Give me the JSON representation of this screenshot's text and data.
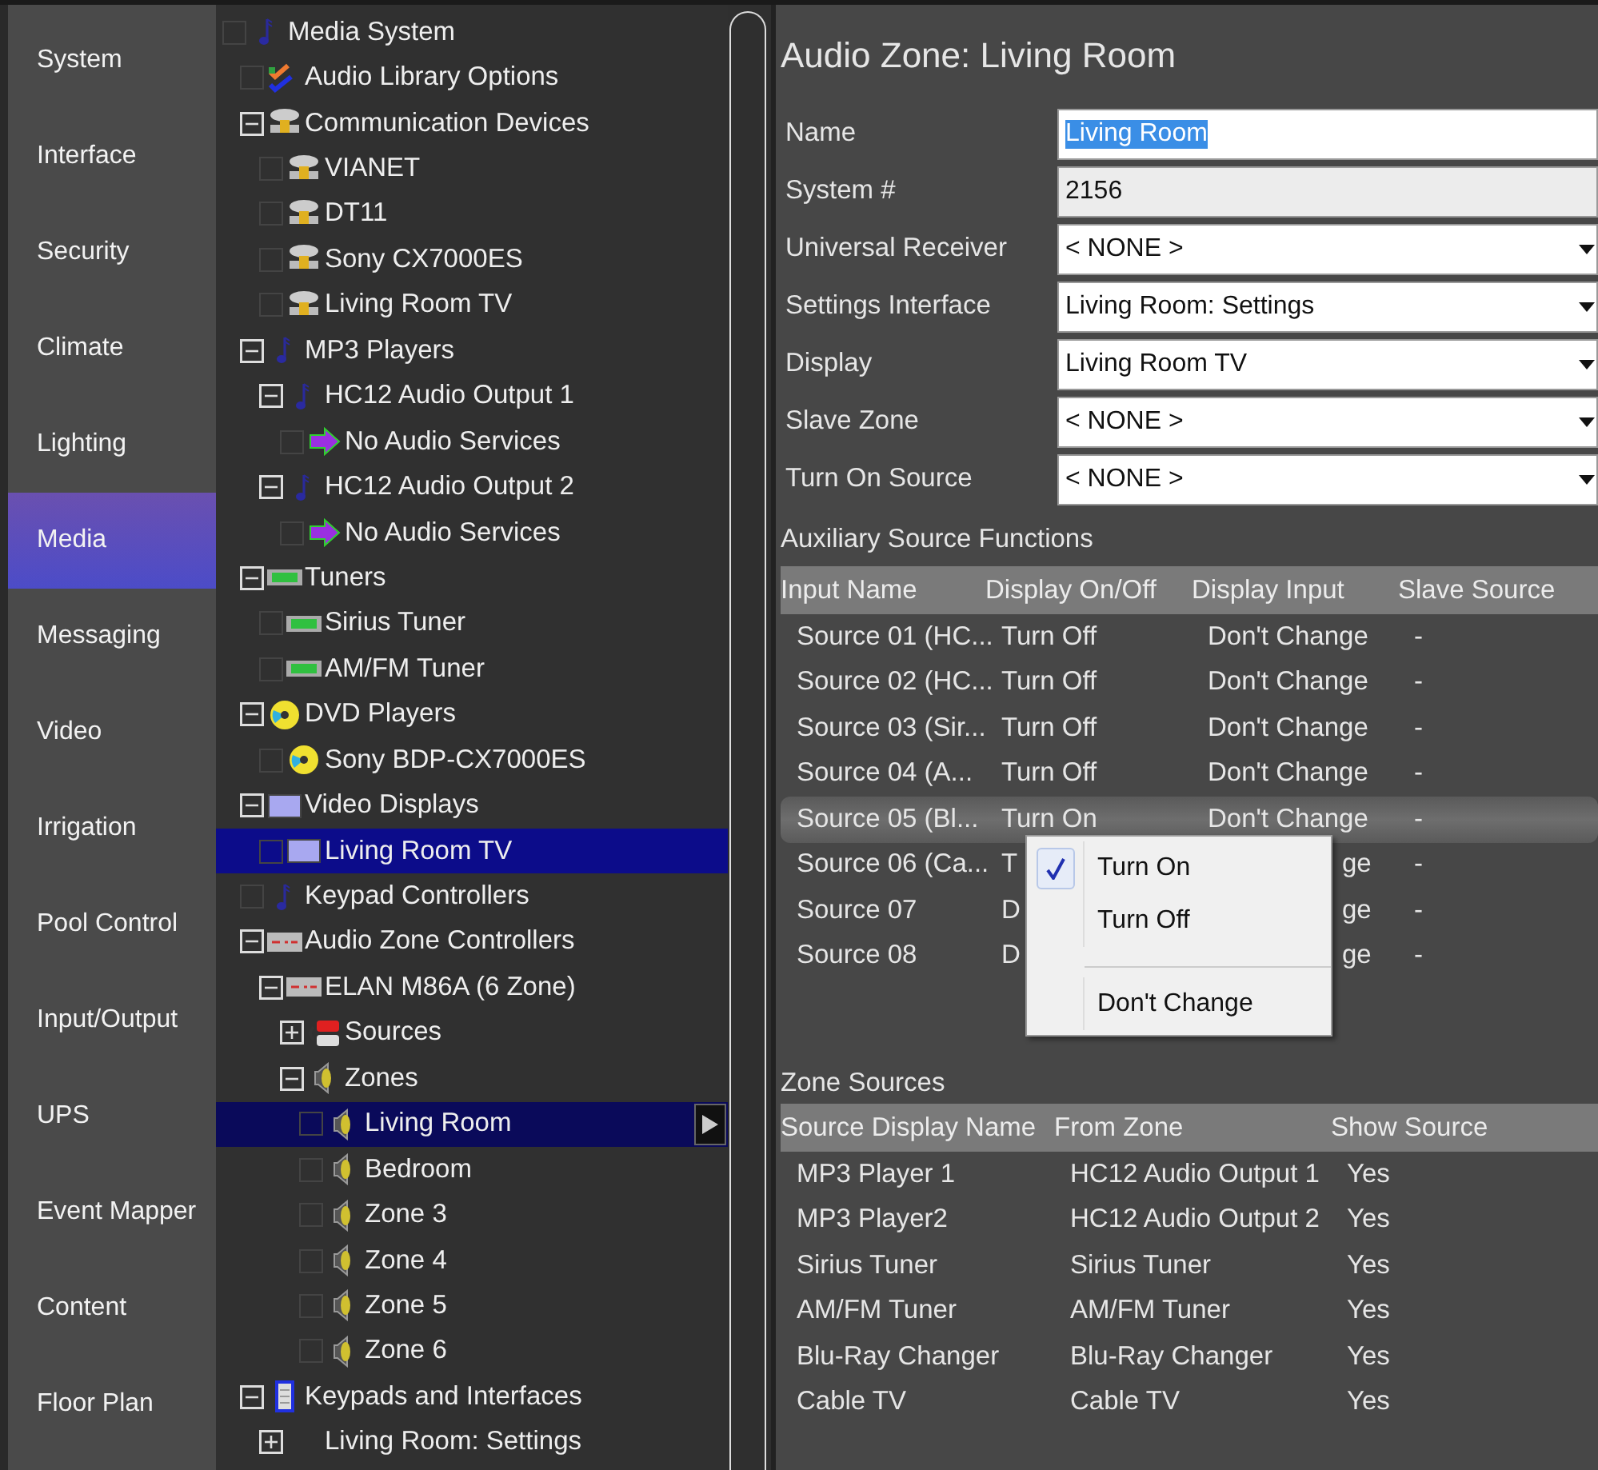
{
  "sidebar": {
    "items": [
      {
        "label": "System",
        "selected": false
      },
      {
        "label": "Interface",
        "selected": false
      },
      {
        "label": "Security",
        "selected": false
      },
      {
        "label": "Climate",
        "selected": false
      },
      {
        "label": "Lighting",
        "selected": false
      },
      {
        "label": "Media",
        "selected": true
      },
      {
        "label": "Messaging",
        "selected": false
      },
      {
        "label": "Video",
        "selected": false
      },
      {
        "label": "Irrigation",
        "selected": false
      },
      {
        "label": "Pool Control",
        "selected": false
      },
      {
        "label": "Input/Output",
        "selected": false
      },
      {
        "label": "UPS",
        "selected": false
      },
      {
        "label": "Event Mapper",
        "selected": false
      },
      {
        "label": "Content",
        "selected": false
      },
      {
        "label": "Floor Plan",
        "selected": false
      }
    ]
  },
  "tree": [
    {
      "label": "Media System",
      "kind": "note",
      "checked": false,
      "selected": false,
      "children": [
        {
          "label": "Audio Library Options",
          "kind": "checklist",
          "checked": false,
          "selected": false
        },
        {
          "label": "Communication Devices",
          "kind": "server",
          "expanded": true,
          "selected": false,
          "children": [
            {
              "label": "VIANET",
              "kind": "server",
              "checked": false,
              "selected": false
            },
            {
              "label": "DT11",
              "kind": "server",
              "checked": false,
              "selected": false
            },
            {
              "label": "Sony CX7000ES",
              "kind": "server",
              "checked": false,
              "selected": false
            },
            {
              "label": "Living Room TV",
              "kind": "server",
              "checked": false,
              "selected": false
            }
          ]
        },
        {
          "label": "MP3 Players",
          "kind": "note",
          "expanded": true,
          "selected": false,
          "children": [
            {
              "label": "HC12 Audio Output 1",
              "kind": "note",
              "expanded": true,
              "selected": false,
              "children": [
                {
                  "label": "No Audio Services",
                  "kind": "arrow",
                  "checked": false,
                  "selected": false
                }
              ]
            },
            {
              "label": "HC12 Audio Output 2",
              "kind": "note",
              "expanded": true,
              "selected": false,
              "children": [
                {
                  "label": "No Audio Services",
                  "kind": "arrow",
                  "checked": false,
                  "selected": false
                }
              ]
            }
          ]
        },
        {
          "label": "Tuners",
          "kind": "tuner",
          "expanded": true,
          "selected": false,
          "children": [
            {
              "label": "Sirius Tuner",
              "kind": "tuner",
              "checked": false,
              "selected": false
            },
            {
              "label": "AM/FM Tuner",
              "kind": "tuner",
              "checked": false,
              "selected": false
            }
          ]
        },
        {
          "label": "DVD Players",
          "kind": "disc",
          "expanded": true,
          "selected": false,
          "children": [
            {
              "label": "Sony BDP-CX7000ES",
              "kind": "disc",
              "checked": false,
              "selected": false
            }
          ]
        },
        {
          "label": "Video Displays",
          "kind": "display",
          "expanded": true,
          "selected": false,
          "children": [
            {
              "label": "Living Room TV",
              "kind": "display",
              "checked": false,
              "selected": true
            }
          ]
        },
        {
          "label": "Keypad Controllers",
          "kind": "note",
          "checked": false,
          "selected": false
        },
        {
          "label": "Audio Zone Controllers",
          "kind": "amp",
          "expanded": true,
          "selected": false,
          "children": [
            {
              "label": "ELAN M86A (6 Zone)",
              "kind": "amp",
              "expanded": true,
              "selected": false,
              "children": [
                {
                  "label": "Sources",
                  "kind": "plugs",
                  "expanded": false,
                  "selected": false
                },
                {
                  "label": "Zones",
                  "kind": "speaker",
                  "expanded": true,
                  "selected": false,
                  "children": [
                    {
                      "label": "Living Room",
                      "kind": "speaker",
                      "checked": false,
                      "selected": true,
                      "action_button": true
                    },
                    {
                      "label": "Bedroom",
                      "kind": "speaker",
                      "checked": false,
                      "selected": false
                    },
                    {
                      "label": "Zone 3",
                      "kind": "speaker",
                      "checked": false,
                      "selected": false
                    },
                    {
                      "label": "Zone 4",
                      "kind": "speaker",
                      "checked": false,
                      "selected": false
                    },
                    {
                      "label": "Zone 5",
                      "kind": "speaker",
                      "checked": false,
                      "selected": false
                    },
                    {
                      "label": "Zone 6",
                      "kind": "speaker",
                      "checked": false,
                      "selected": false
                    }
                  ]
                }
              ]
            }
          ]
        },
        {
          "label": "Keypads and Interfaces",
          "kind": "keypad",
          "expanded": true,
          "selected": false,
          "children": [
            {
              "label": "Living Room: Settings",
              "kind": "none",
              "expanded": false,
              "selected": false
            }
          ]
        }
      ]
    }
  ],
  "panel": {
    "title": "Audio Zone: Living Room",
    "fields": [
      {
        "label": "Name",
        "kind": "text",
        "value": "Living Room",
        "value_selected": true
      },
      {
        "label": "System #",
        "kind": "readonly",
        "value": "2156"
      },
      {
        "label": "Universal Receiver",
        "kind": "dropdown",
        "value": "< NONE >"
      },
      {
        "label": "Settings Interface",
        "kind": "dropdown",
        "value": "Living Room: Settings"
      },
      {
        "label": "Display",
        "kind": "dropdown",
        "value": "Living Room TV"
      },
      {
        "label": "Slave Zone",
        "kind": "dropdown",
        "value": "< NONE >"
      },
      {
        "label": "Turn On Source",
        "kind": "dropdown",
        "value": "< NONE >"
      }
    ],
    "aux": {
      "title": "Auxiliary Source Functions",
      "columns": [
        "Input Name",
        "Display On/Off",
        "Display Input",
        "Slave Source"
      ],
      "rows": [
        {
          "cells": [
            "Source 01 (HC...",
            "Turn Off",
            "Don't Change",
            "-"
          ],
          "selected": false,
          "under_menu": false
        },
        {
          "cells": [
            "Source 02 (HC...",
            "Turn Off",
            "Don't Change",
            "-"
          ],
          "selected": false,
          "under_menu": false
        },
        {
          "cells": [
            "Source 03 (Sir...",
            "Turn Off",
            "Don't Change",
            "-"
          ],
          "selected": false,
          "under_menu": false
        },
        {
          "cells": [
            "Source 04 (A...",
            "Turn Off",
            "Don't Change",
            "-"
          ],
          "selected": false,
          "under_menu": false
        },
        {
          "cells": [
            "Source 05 (Bl...",
            "Turn On",
            "Don't Change",
            "-"
          ],
          "selected": true,
          "under_menu": false
        },
        {
          "cells": [
            "Source 06 (Ca...",
            "T",
            "ge",
            "-"
          ],
          "selected": false,
          "under_menu": true
        },
        {
          "cells": [
            "Source 07",
            "D",
            "ge",
            "-"
          ],
          "selected": false,
          "under_menu": true
        },
        {
          "cells": [
            "Source 08",
            "D",
            "ge",
            "-"
          ],
          "selected": false,
          "under_menu": true
        }
      ],
      "menu": {
        "items": [
          {
            "kind": "item",
            "label": "Turn On",
            "checked": true
          },
          {
            "kind": "item",
            "label": "Turn Off",
            "checked": false
          },
          {
            "kind": "separator"
          },
          {
            "kind": "item",
            "label": "Don't Change",
            "checked": false
          }
        ]
      }
    },
    "zone_sources": {
      "title": "Zone Sources",
      "columns": [
        "Source Display Name",
        "From Zone",
        "Show Source"
      ],
      "rows": [
        [
          "MP3 Player 1",
          "HC12 Audio Output 1",
          "Yes"
        ],
        [
          "MP3 Player2",
          "HC12 Audio Output 2",
          "Yes"
        ],
        [
          "Sirius Tuner",
          "Sirius Tuner",
          "Yes"
        ],
        [
          "AM/FM Tuner",
          "AM/FM Tuner",
          "Yes"
        ],
        [
          "Blu-Ray Changer",
          "Blu-Ray Changer",
          "Yes"
        ],
        [
          "Cable TV",
          "Cable TV",
          "Yes"
        ]
      ]
    }
  }
}
